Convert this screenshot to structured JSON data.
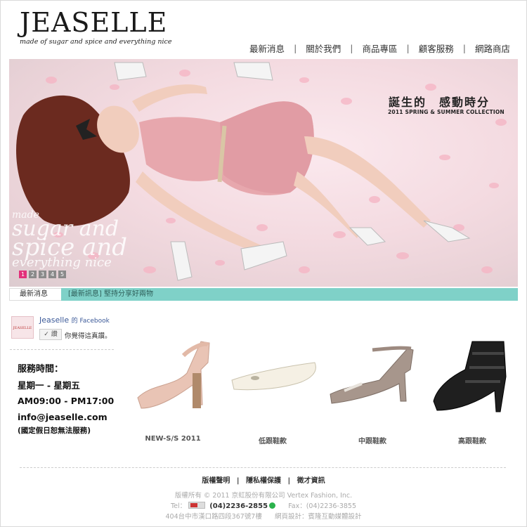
{
  "header": {
    "logo": "JEASELLE",
    "tagline": "made of sugar and spice and everything nice",
    "nav": [
      {
        "label": "最新消息"
      },
      {
        "label": "關於我們"
      },
      {
        "label": "商品專區"
      },
      {
        "label": "顧客服務"
      },
      {
        "label": "網路商店"
      }
    ],
    "nav_separator": "|"
  },
  "hero": {
    "title": "誕生的　感動時分",
    "subtitle": "2011 SPRING & SUMMER COLLECTION",
    "script_lines": [
      "made",
      "sugar and",
      "spice and",
      "everything nice"
    ],
    "pager": [
      "1",
      "2",
      "3",
      "4",
      "5"
    ],
    "active_page": "1"
  },
  "ticker": {
    "label": "最新消息",
    "text": "[最新訊息] 堅持分享好兩物"
  },
  "facebook": {
    "name": "Jeaselle",
    "suffix": "的 Facebook",
    "avatar_text": "JEASELLE",
    "like_label": "讚",
    "note": "你覺得這真讚。"
  },
  "service": {
    "title": "服務時間：",
    "days": "星期一 - 星期五",
    "hours": "AM09:00 - PM17:00",
    "email": "info@jeaselle.com",
    "note": "(國定假日恕無法服務)"
  },
  "products": [
    {
      "label": "NEW-S/S 2011"
    },
    {
      "label": "低跟鞋款"
    },
    {
      "label": "中跟鞋款"
    },
    {
      "label": "高跟鞋款"
    }
  ],
  "footer": {
    "links": [
      "版權聲明",
      "隱私權保護",
      "徵才資訊"
    ],
    "copyright": "版權所有 © 2011 京虹股份有限公司 Vertex Fashion, Inc.",
    "tel_label": "Tel：",
    "tel": "(04)2236-2855",
    "fax": "Fax：(04)2236-3855",
    "address": "404台中市漢口路四段367號7樓",
    "design": "網頁設計：賓隆互動媒體設計"
  },
  "colors": {
    "ticker_bg": "#7fd1c8",
    "pager_active": "#e2307a",
    "facebook_blue": "#3b5998"
  }
}
